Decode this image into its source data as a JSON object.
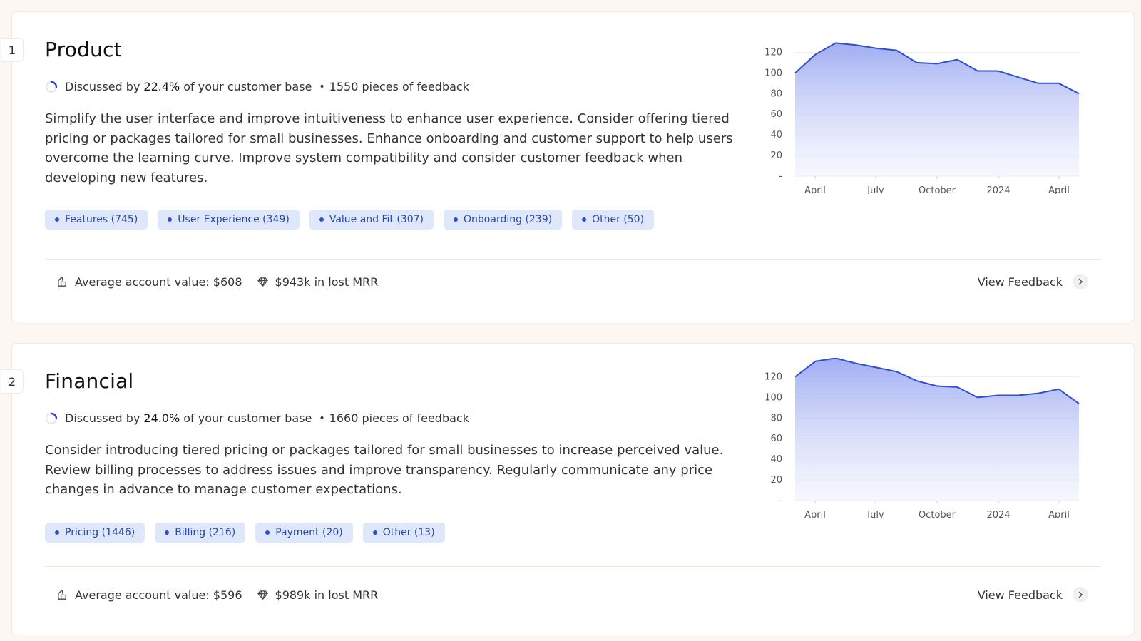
{
  "colors": {
    "accent": "#2d4ed6",
    "tag_bg": "#dfe7fb",
    "tag_text": "#2b46a8",
    "page_bg": "#fcf7f3"
  },
  "topics": [
    {
      "rank": "1",
      "title": "Product",
      "discussed_prefix": "Discussed by",
      "percent": "22.4%",
      "discussed_suffix": "of your customer base",
      "separator": "•",
      "feedback_count": "1550 pieces of feedback",
      "summary": "Simplify the user interface and improve intuitiveness to enhance user experience. Consider offering tiered pricing or packages tailored for small businesses. Enhance onboarding and customer support to help users overcome the learning curve. Improve system compatibility and consider customer feedback when developing new features.",
      "tags": [
        "Features (745)",
        "User Experience (349)",
        "Value and Fit (307)",
        "Onboarding (239)",
        "Other (50)"
      ],
      "avg_account_value": "Average account value: $608",
      "lost_mrr": "$943k in lost MRR",
      "view_label": "View Feedback",
      "icons": {
        "value": "coin-stack-icon",
        "mrr": "diamond-icon",
        "chevron": "chevron-right-icon",
        "progress": "progress-ring-icon"
      },
      "chart_data": {
        "type": "area",
        "yticks": [
          "-",
          "20",
          "40",
          "60",
          "80",
          "100",
          "120"
        ],
        "ylim": [
          0,
          130
        ],
        "xticks": [
          "April",
          "July",
          "October",
          "2024",
          "April"
        ],
        "values": [
          100,
          118,
          129,
          127,
          124,
          122,
          110,
          109,
          113,
          102,
          102,
          96,
          90,
          90,
          80
        ]
      }
    },
    {
      "rank": "2",
      "title": "Financial",
      "discussed_prefix": "Discussed by",
      "percent": "24.0%",
      "discussed_suffix": "of your customer base",
      "separator": "•",
      "feedback_count": "1660 pieces of feedback",
      "summary": "Consider introducing tiered pricing or packages tailored for small businesses to increase perceived value. Review billing processes to address issues and improve transparency. Regularly communicate any price changes in advance to manage customer expectations.",
      "tags": [
        "Pricing (1446)",
        "Billing (216)",
        "Payment (20)",
        "Other (13)"
      ],
      "avg_account_value": "Average account value: $596",
      "lost_mrr": "$989k in lost MRR",
      "view_label": "View Feedback",
      "icons": {
        "value": "coin-stack-icon",
        "mrr": "diamond-icon",
        "chevron": "chevron-right-icon",
        "progress": "progress-ring-icon"
      },
      "chart_data": {
        "type": "area",
        "yticks": [
          "-",
          "20",
          "40",
          "60",
          "80",
          "100",
          "120"
        ],
        "ylim": [
          0,
          130
        ],
        "xticks": [
          "April",
          "July",
          "October",
          "2024",
          "April"
        ],
        "values": [
          120,
          135,
          138,
          133,
          129,
          125,
          116,
          111,
          110,
          100,
          102,
          102,
          104,
          108,
          94
        ]
      }
    }
  ]
}
